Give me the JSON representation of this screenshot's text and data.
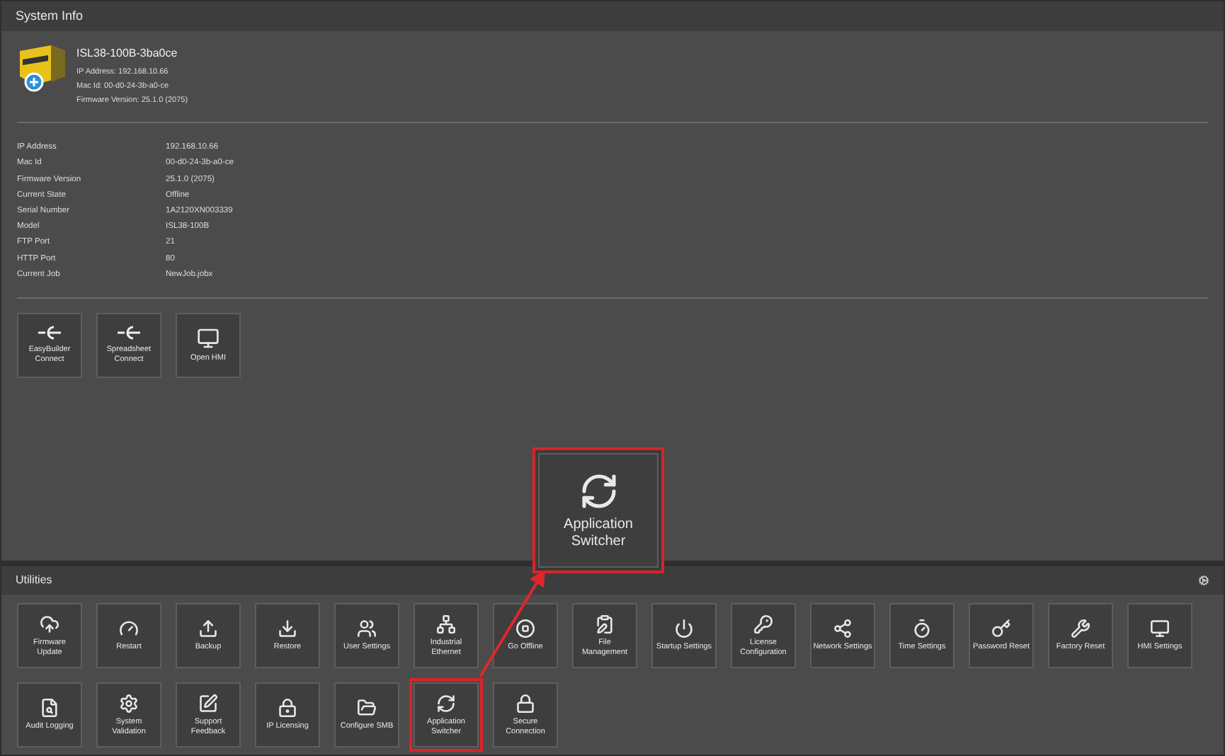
{
  "system_info": {
    "title": "System Info",
    "device": {
      "name": "ISL38-100B-3ba0ce",
      "lines": [
        "IP Address: 192.168.10.66",
        "Mac Id: 00-d0-24-3b-a0-ce",
        "Firmware Version: 25.1.0 (2075)"
      ]
    },
    "properties": [
      {
        "label": "IP Address",
        "value": "192.168.10.66"
      },
      {
        "label": "Mac Id",
        "value": "00-d0-24-3b-a0-ce"
      },
      {
        "label": "Firmware Version",
        "value": "25.1.0 (2075)"
      },
      {
        "label": "Current State",
        "value": "Offline"
      },
      {
        "label": "Serial Number",
        "value": "1A2120XN003339"
      },
      {
        "label": "Model",
        "value": "ISL38-100B"
      },
      {
        "label": "FTP Port",
        "value": "21"
      },
      {
        "label": "HTTP Port",
        "value": "80"
      },
      {
        "label": "Current Job",
        "value": "NewJob.jobx"
      }
    ],
    "actions": [
      "EasyBuilder Connect",
      "Spreadsheet Connect",
      "Open HMI"
    ]
  },
  "utilities": {
    "title": "Utilities",
    "rows": [
      [
        {
          "label": "Firmware Update",
          "highlighted": false
        },
        {
          "label": "Restart",
          "highlighted": false
        },
        {
          "label": "Backup",
          "highlighted": false
        },
        {
          "label": "Restore",
          "highlighted": false
        },
        {
          "label": "User Settings",
          "highlighted": false
        },
        {
          "label": "Industrial Ethernet",
          "highlighted": false
        },
        {
          "label": "Go Offline",
          "highlighted": false
        },
        {
          "label": "File Management",
          "highlighted": false
        },
        {
          "label": "Startup Settings",
          "highlighted": false
        },
        {
          "label": "License Configuration",
          "highlighted": false
        },
        {
          "label": "Network Settings",
          "highlighted": false
        },
        {
          "label": "Time Settings",
          "highlighted": false
        },
        {
          "label": "Password Reset",
          "highlighted": false
        },
        {
          "label": "Factory Reset",
          "highlighted": false
        },
        {
          "label": "HMI Settings",
          "highlighted": false
        }
      ],
      [
        {
          "label": "Audit Logging",
          "highlighted": false
        },
        {
          "label": "System Validation",
          "highlighted": false
        },
        {
          "label": "Support Feedback",
          "highlighted": false
        },
        {
          "label": "IP Licensing",
          "highlighted": false
        },
        {
          "label": "Configure SMB",
          "highlighted": false
        },
        {
          "label": "Application Switcher",
          "highlighted": true
        },
        {
          "label": "Secure Connection",
          "highlighted": false
        }
      ]
    ]
  },
  "callout": {
    "label": "Application Switcher"
  }
}
